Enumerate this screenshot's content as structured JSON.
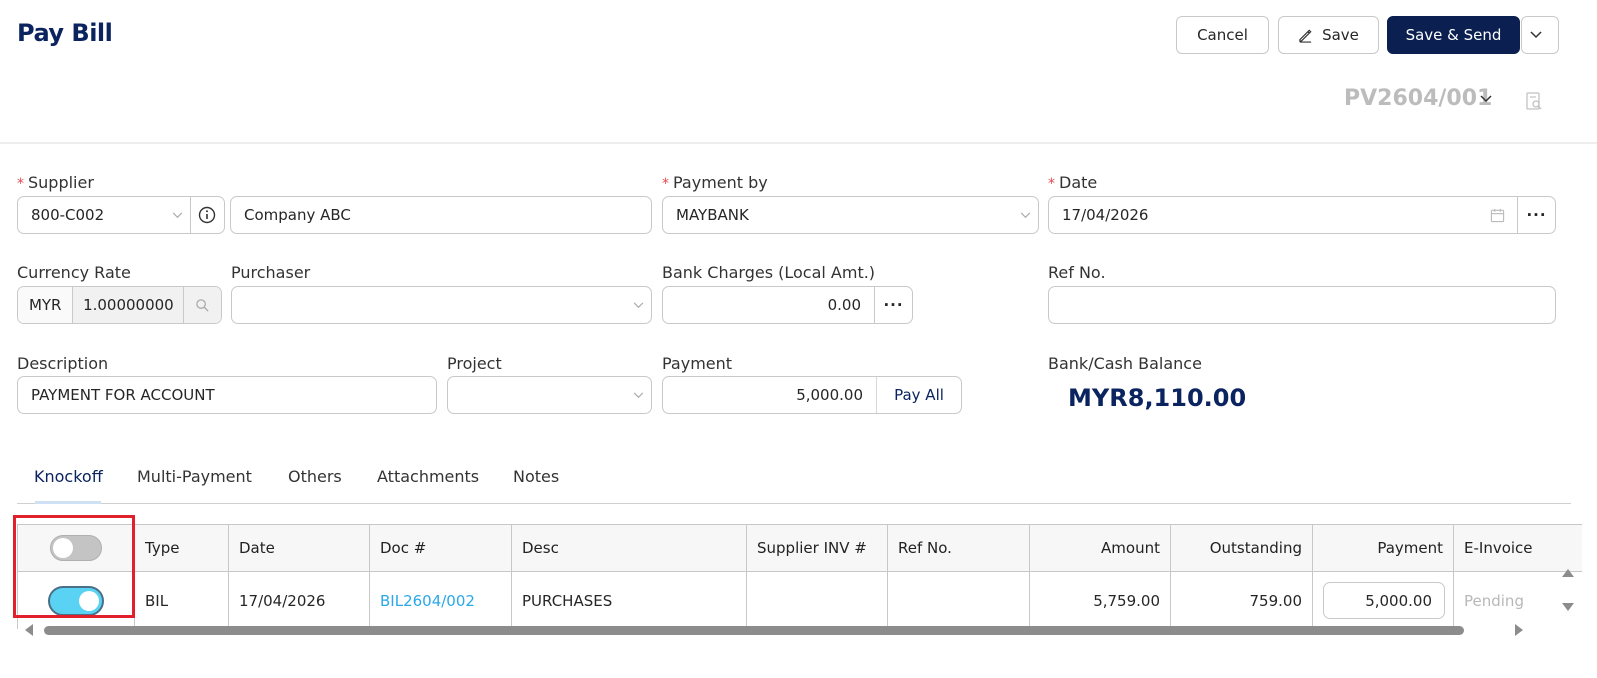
{
  "header": {
    "title": "Pay Bill",
    "cancel_label": "Cancel",
    "save_label": "Save",
    "save_send_label": "Save & Send",
    "doc_number": "PV2604/001"
  },
  "form": {
    "supplier_label": "Supplier",
    "supplier_code": "800-C002",
    "supplier_name": "Company ABC",
    "payment_by_label": "Payment by",
    "payment_by_value": "MAYBANK",
    "date_label": "Date",
    "date_value": "17/04/2026",
    "currency_rate_label": "Currency Rate",
    "currency_code": "MYR",
    "currency_rate": "1.00000000",
    "purchaser_label": "Purchaser",
    "purchaser_value": "",
    "bank_charges_label": "Bank Charges (Local Amt.)",
    "bank_charges_value": "0.00",
    "ref_no_label": "Ref No.",
    "ref_no_value": "",
    "description_label": "Description",
    "description_value": "PAYMENT FOR ACCOUNT",
    "project_label": "Project",
    "project_value": "",
    "payment_label": "Payment",
    "payment_value": "5,000.00",
    "pay_all_label": "Pay All",
    "balance_label": "Bank/Cash Balance",
    "balance_value": "MYR8,110.00"
  },
  "tabs": [
    {
      "label": "Knockoff",
      "active": true
    },
    {
      "label": "Multi-Payment"
    },
    {
      "label": "Others"
    },
    {
      "label": "Attachments"
    },
    {
      "label": "Notes"
    }
  ],
  "table": {
    "headers": [
      "Type",
      "Date",
      "Doc #",
      "Desc",
      "Supplier INV #",
      "Ref No.",
      "Amount",
      "Outstanding",
      "Payment",
      "E-Invoice"
    ],
    "rows": [
      {
        "selected": true,
        "type": "BIL",
        "date": "17/04/2026",
        "doc": "BIL2604/002",
        "desc": "PURCHASES",
        "supplier_inv": "",
        "ref_no": "",
        "amount": "5,759.00",
        "outstanding": "759.00",
        "payment": "5,000.00",
        "einvoice": "Pending"
      }
    ]
  },
  "colors": {
    "brand": "#0b2460",
    "primary_button": "#0b1f50",
    "link": "#2aa8e8",
    "toggle_on": "#5ad2f4",
    "highlight": "#e0202a"
  }
}
